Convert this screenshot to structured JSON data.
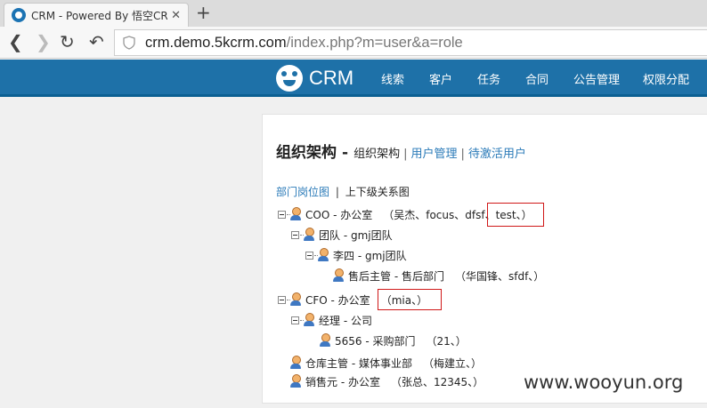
{
  "browser": {
    "tab_title": "CRM - Powered By 悟空CRM",
    "tab_close": "✕",
    "new_tab": "+",
    "url_host": "crm.demo.5kcrm.com",
    "url_path": "/index.php?m=user&a=role"
  },
  "app": {
    "brand": "CRM",
    "nav": [
      "线索",
      "客户",
      "任务",
      "合同",
      "公告管理",
      "权限分配"
    ]
  },
  "page": {
    "title": "组织架构",
    "title_sep": "-",
    "current": "组织架构",
    "sep": "|",
    "links": [
      "用户管理",
      "待激活用户"
    ],
    "subtabs": {
      "link": "部门岗位图",
      "sep": "|",
      "current": "上下级关系图"
    }
  },
  "tree": [
    {
      "label": "COO - 办公室",
      "members": "（吴杰、focus、dfsf、test、）"
    },
    {
      "label": "团队 - gmj团队",
      "members": ""
    },
    {
      "label": "李四 - gmj团队",
      "members": ""
    },
    {
      "label": "售后主管 - 售后部门",
      "members": "（华国锋、sfdf、）"
    },
    {
      "label": "CFO - 办公室",
      "members": "（mia、）"
    },
    {
      "label": "经理 - 公司",
      "members": ""
    },
    {
      "label": "5656 - 采购部门",
      "members": "（21、）"
    },
    {
      "label": "仓库主管 - 媒体事业部",
      "members": "（梅建立、）"
    },
    {
      "label": "销售元 - 办公室",
      "members": "（张总、12345、）"
    }
  ],
  "watermark": "www.wooyun.org",
  "colors": {
    "header": "#1e71a8",
    "link": "#2a7ab8",
    "highlight": "#d01818"
  }
}
